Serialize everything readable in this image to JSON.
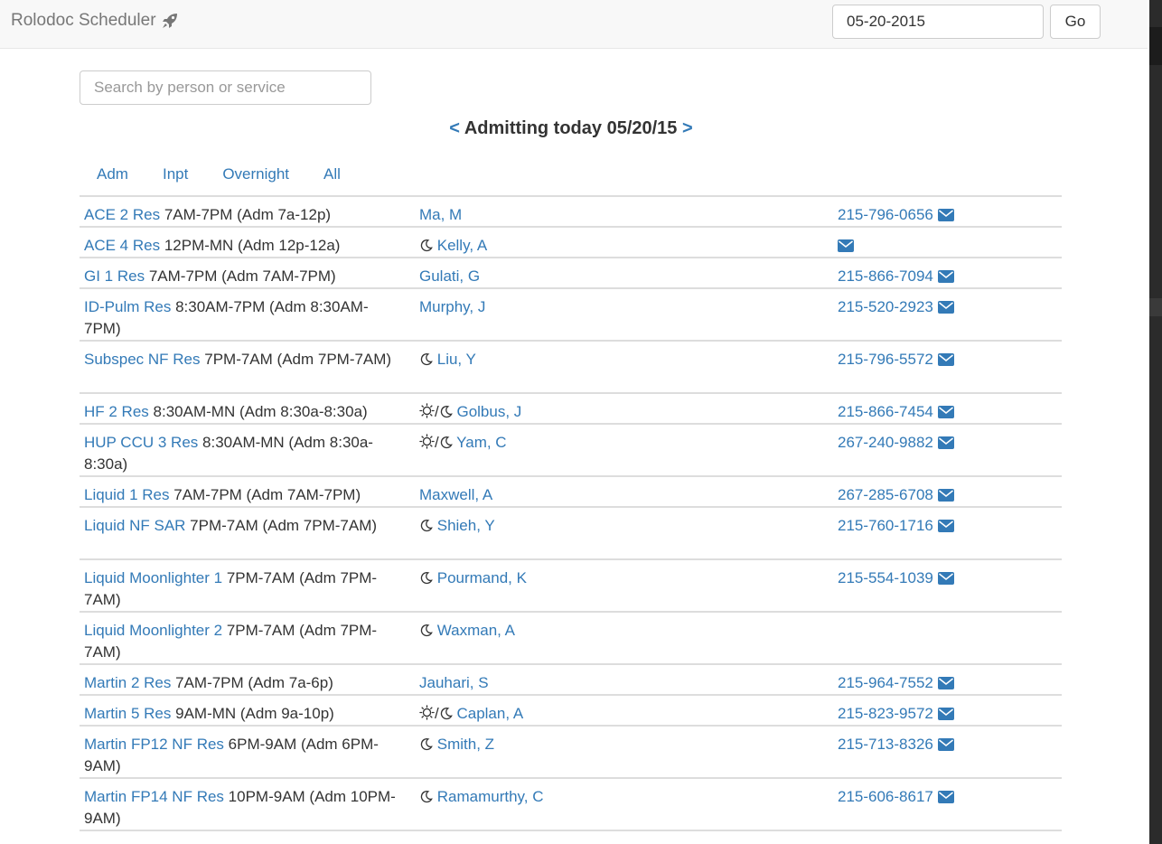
{
  "navbar": {
    "brand": "Rolodoc Scheduler",
    "brand_icon": "rocket-icon",
    "date_value": "05-20-2015",
    "go_label": "Go"
  },
  "search": {
    "placeholder": "Search by person or service"
  },
  "heading": {
    "prev": "<",
    "title": "Admitting today 05/20/15",
    "next": ">"
  },
  "tabs": [
    {
      "label": "Adm"
    },
    {
      "label": "Inpt"
    },
    {
      "label": "Overnight"
    },
    {
      "label": "All"
    }
  ],
  "colors": {
    "link": "#337ab7",
    "text": "#333333",
    "border": "#dddddd"
  },
  "rows": [
    {
      "service": "ACE 2 Res",
      "hours": "7AM-7PM (Adm 7a-12p)",
      "icon": "none",
      "person": "Ma, M",
      "phone": "215-796-0656",
      "email": true
    },
    {
      "service": "ACE 4 Res",
      "hours": "12PM-MN (Adm 12p-12a)",
      "icon": "moon",
      "person": "Kelly, A",
      "phone": "",
      "email": true
    },
    {
      "service": "GI 1 Res",
      "hours": "7AM-7PM (Adm 7AM-7PM)",
      "icon": "none",
      "person": "Gulati, G",
      "phone": "215-866-7094",
      "email": true
    },
    {
      "service": "ID-Pulm Res",
      "hours": "8:30AM-7PM (Adm 8:30AM-7PM)",
      "icon": "none",
      "person": "Murphy, J",
      "phone": "215-520-2923",
      "email": true
    },
    {
      "service": "Subspec NF Res",
      "hours": "7PM-7AM (Adm 7PM-7AM)",
      "icon": "moon",
      "person": "Liu, Y",
      "phone": "215-796-5572",
      "email": true
    },
    {
      "service": "HF 2 Res",
      "hours": "8:30AM-MN (Adm 8:30a-8:30a)",
      "icon": "sun-moon",
      "person": "Golbus, J",
      "phone": "215-866-7454",
      "email": true
    },
    {
      "service": "HUP CCU 3 Res",
      "hours": "8:30AM-MN (Adm 8:30a-8:30a)",
      "icon": "sun-moon",
      "person": "Yam, C",
      "phone": "267-240-9882",
      "email": true
    },
    {
      "service": "Liquid 1 Res",
      "hours": "7AM-7PM (Adm 7AM-7PM)",
      "icon": "none",
      "person": "Maxwell, A",
      "phone": "267-285-6708",
      "email": true
    },
    {
      "service": "Liquid NF SAR",
      "hours": "7PM-7AM (Adm 7PM-7AM)",
      "icon": "moon",
      "person": "Shieh, Y",
      "phone": "215-760-1716",
      "email": true
    },
    {
      "service": "Liquid Moonlighter 1",
      "hours": "7PM-7AM (Adm 7PM-7AM)",
      "icon": "moon",
      "person": "Pourmand, K",
      "phone": "215-554-1039",
      "email": true
    },
    {
      "service": "Liquid Moonlighter 2",
      "hours": "7PM-7AM (Adm 7PM-7AM)",
      "icon": "moon",
      "person": "Waxman, A",
      "phone": "",
      "email": false
    },
    {
      "service": "Martin 2 Res",
      "hours": "7AM-7PM (Adm 7a-6p)",
      "icon": "none",
      "person": "Jauhari, S",
      "phone": "215-964-7552",
      "email": true
    },
    {
      "service": "Martin 5 Res",
      "hours": "9AM-MN (Adm 9a-10p)",
      "icon": "sun-moon",
      "person": "Caplan, A",
      "phone": "215-823-9572",
      "email": true
    },
    {
      "service": "Martin FP12 NF Res",
      "hours": "6PM-9AM (Adm 6PM-9AM)",
      "icon": "moon",
      "person": "Smith, Z",
      "phone": "215-713-8326",
      "email": true
    },
    {
      "service": "Martin FP14 NF Res",
      "hours": "10PM-9AM (Adm 10PM-9AM)",
      "icon": "moon",
      "person": "Ramamurthy, C",
      "phone": "215-606-8617",
      "email": true
    }
  ]
}
